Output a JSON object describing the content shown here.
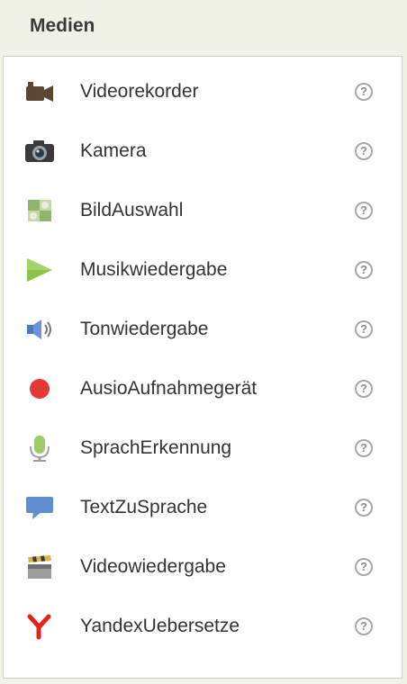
{
  "header": {
    "title": "Medien"
  },
  "items": [
    {
      "label": "Videorekorder",
      "icon": "video-camera-icon"
    },
    {
      "label": "Kamera",
      "icon": "camera-icon"
    },
    {
      "label": "BildAuswahl",
      "icon": "image-picker-icon"
    },
    {
      "label": "Musikwiedergabe",
      "icon": "play-icon"
    },
    {
      "label": "Tonwiedergabe",
      "icon": "speaker-icon"
    },
    {
      "label": "AusioAufnahmegerät",
      "icon": "record-icon"
    },
    {
      "label": "SprachErkennung",
      "icon": "microphone-icon"
    },
    {
      "label": "TextZuSprache",
      "icon": "speech-bubble-icon"
    },
    {
      "label": "Videowiedergabe",
      "icon": "clapperboard-icon"
    },
    {
      "label": "YandexUebersetze",
      "icon": "yandex-icon"
    }
  ],
  "help_glyph": "?",
  "colors": {
    "header_bg": "#f1f2e6",
    "record_red": "#e53935",
    "play_green": "#8bc34a",
    "yandex_red": "#e62117",
    "speech_blue": "#5f8fcf"
  }
}
